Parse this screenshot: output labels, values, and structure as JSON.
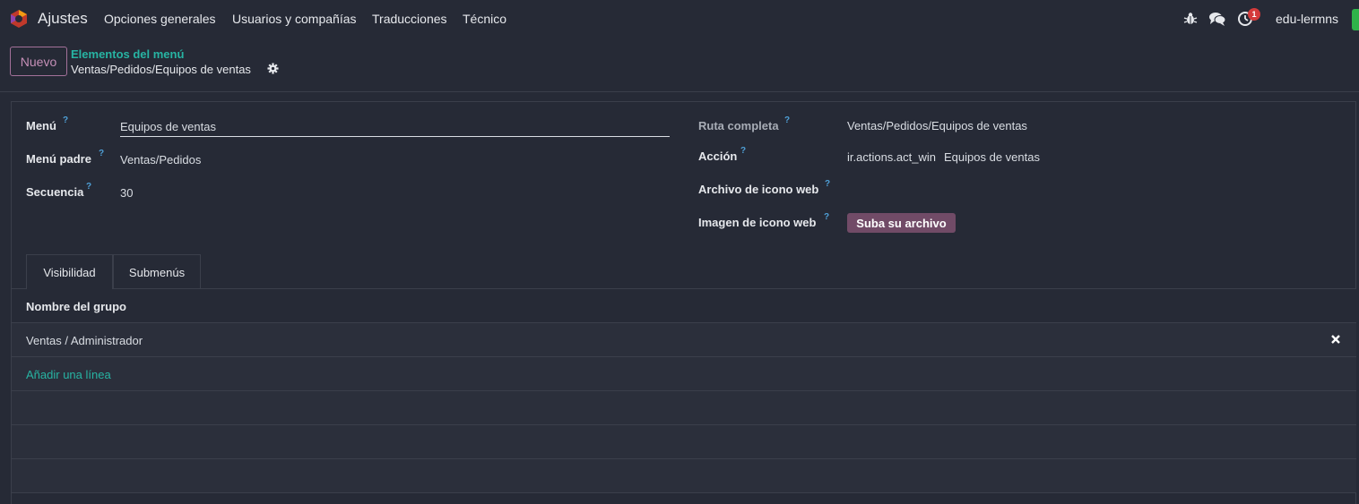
{
  "navbar": {
    "app_name": "Ajustes",
    "menu": [
      "Opciones generales",
      "Usuarios y compañías",
      "Traducciones",
      "Técnico"
    ],
    "activity_count": "1",
    "user": "edu-lermns"
  },
  "control_panel": {
    "new_button": "Nuevo",
    "breadcrumb_parent": "Elementos del menú",
    "breadcrumb_current": "Ventas/Pedidos/Equipos de ventas"
  },
  "form": {
    "left": {
      "menu_label": "Menú",
      "menu_value": "Equipos de ventas",
      "parent_label": "Menú padre",
      "parent_value": "Ventas/Pedidos",
      "sequence_label": "Secuencia",
      "sequence_value": "30"
    },
    "right": {
      "full_path_label": "Ruta completa",
      "full_path_value": "Ventas/Pedidos/Equipos de ventas",
      "action_label": "Acción",
      "action_model": "ir.actions.act_win",
      "action_value": "Equipos de ventas",
      "web_icon_file_label": "Archivo de icono web",
      "web_icon_image_label": "Imagen de icono web",
      "upload_button": "Suba su archivo"
    },
    "help_mark": "?"
  },
  "tabs": [
    {
      "label": "Visibilidad",
      "active": true
    },
    {
      "label": "Submenús",
      "active": false
    }
  ],
  "table": {
    "header": "Nombre del grupo",
    "rows": [
      "Ventas / Administrador"
    ],
    "add_line": "Añadir una línea"
  },
  "colors": {
    "background": "#262a36",
    "accent_teal": "#27b4a3",
    "primary_purple": "#714b67",
    "help_blue": "#4fa0d7",
    "badge_red": "#d43b3b"
  }
}
